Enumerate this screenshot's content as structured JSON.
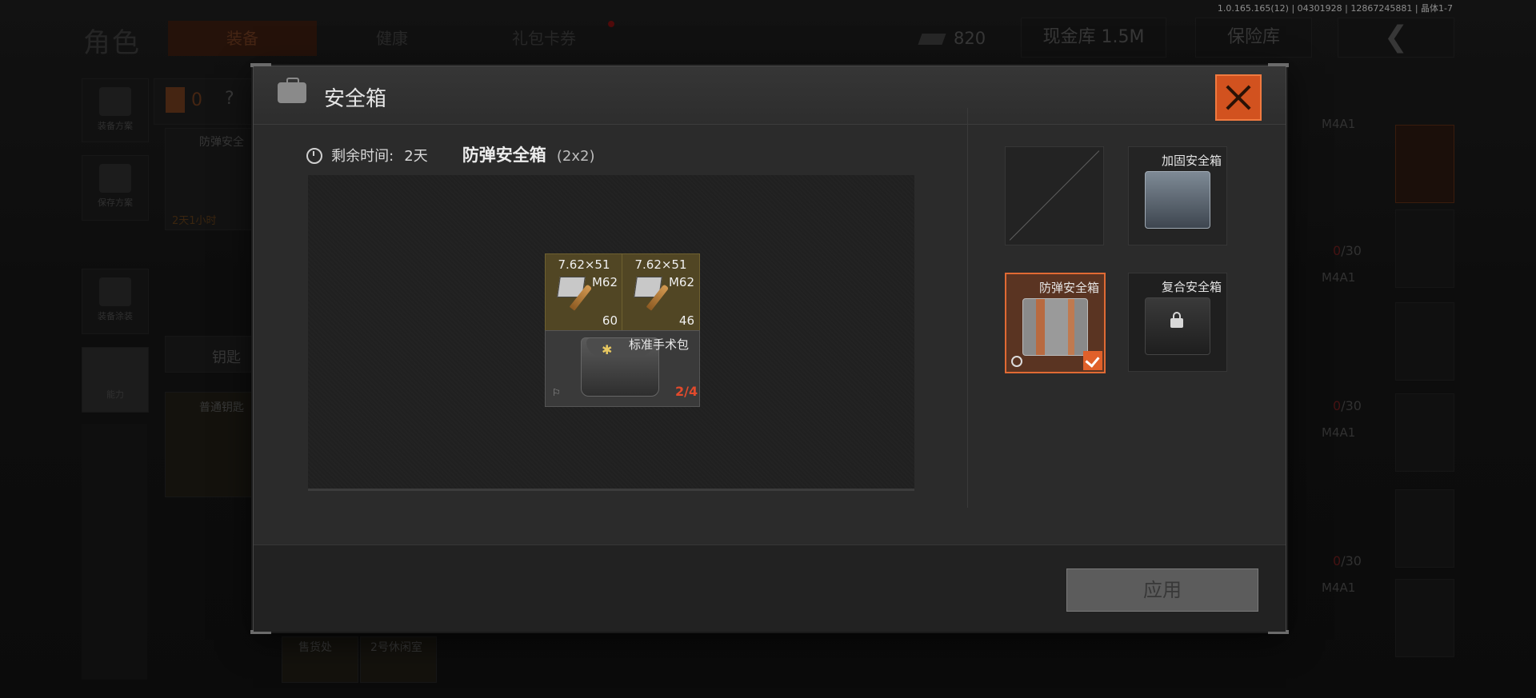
{
  "version": "1.0.165.165(12) | 04301928 | 12867245881 | 晶体1-7",
  "background": {
    "page_title": "角色",
    "tabs": [
      "装备",
      "健康",
      "礼包卡券"
    ],
    "currency_amount": "820",
    "cash_storage_label": "现金库 1.5M",
    "safe_storage_label": "保险库",
    "left_sidebar": [
      "装备方案",
      "保存方案",
      "装备涂装",
      "能力"
    ],
    "equipped_count": "0",
    "equipped_unknown": "?",
    "equipped_case_name": "防弹安全",
    "equipped_case_timer": "2天1小时",
    "key_label": "钥匙",
    "key_item_name": "普通钥匙",
    "bottom_items": [
      "售货处",
      "2号休闲室"
    ],
    "weapons": [
      {
        "name": "M4A1",
        "ammo_current": "0",
        "ammo_total": "/30"
      },
      {
        "name": "M4A1",
        "ammo_current": "0",
        "ammo_total": "/30"
      },
      {
        "name": "M4A1",
        "ammo_current": "0",
        "ammo_total": "/30"
      },
      {
        "name": "M4A1",
        "ammo_current": "",
        "ammo_total": ""
      }
    ]
  },
  "modal": {
    "title": "安全箱",
    "time_label": "剩余时间:",
    "time_value": "2天",
    "case_name": "防弹安全箱",
    "case_size": "(2x2)",
    "slots": [
      {
        "caliber": "7.62×51",
        "model": "M62",
        "count": "60"
      },
      {
        "caliber": "7.62×51",
        "model": "M62",
        "count": "46"
      }
    ],
    "medkit": {
      "name": "标准手术包",
      "uses": "2/4",
      "star": "✱"
    },
    "case_options": [
      {
        "name": "",
        "state": "empty"
      },
      {
        "name": "加固安全箱",
        "state": "available"
      },
      {
        "name": "防弹安全箱",
        "state": "selected"
      },
      {
        "name": "复合安全箱",
        "state": "locked"
      }
    ],
    "apply_label": "应用"
  },
  "colors": {
    "accent_orange": "#e0602a",
    "ammo_slot": "#514624",
    "medkit_uses": "#e24a2c"
  },
  "icons": [
    "case-icon",
    "close-icon",
    "clock-icon",
    "check-icon",
    "lock-icon",
    "timer-icon"
  ]
}
